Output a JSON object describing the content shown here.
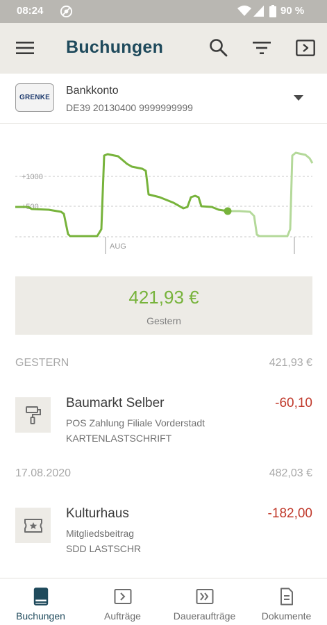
{
  "status_bar": {
    "time": "08:24",
    "battery": "90 %"
  },
  "app_bar": {
    "title": "Buchungen",
    "icons": [
      "menu-icon",
      "search-icon",
      "filter-icon",
      "export-icon"
    ]
  },
  "account": {
    "logo_text": "GRENKE",
    "name": "Bankkonto",
    "iban": "DE39 20130400 9999999999"
  },
  "chart_data": {
    "type": "line",
    "y_tick_labels": [
      "+1000",
      "+500"
    ],
    "x_tick_labels": [
      "AUG"
    ],
    "colors": {
      "past": "#77b33b",
      "forecast": "#b4d99a"
    }
  },
  "balance": {
    "amount": "421,93 €",
    "label": "Gestern"
  },
  "sections": [
    {
      "date": "GESTERN",
      "total": "421,93 €",
      "transactions": [
        {
          "title": "Baumarkt Selber",
          "line1": "POS Zahlung Filiale Vorderstadt",
          "line2": "KARTENLASTSCHRIFT",
          "amount": "-60,10",
          "icon": "paint-roller-icon"
        }
      ]
    },
    {
      "date": "17.08.2020",
      "total": "482,03 €",
      "transactions": [
        {
          "title": "Kulturhaus",
          "line1": "Mitgliedsbeitrag",
          "line2": "SDD LASTSCHR",
          "amount": "-182,00",
          "icon": "ticket-icon"
        }
      ]
    }
  ],
  "bottom_nav": [
    {
      "label": "Buchungen",
      "icon": "book-icon",
      "active": true
    },
    {
      "label": "Aufträge",
      "icon": "transfer-icon",
      "active": false
    },
    {
      "label": "Daueraufträge",
      "icon": "recurring-transfer-icon",
      "active": false
    },
    {
      "label": "Dokumente",
      "icon": "document-icon",
      "active": false
    }
  ],
  "colors": {
    "accent": "#1f4a5c",
    "positive": "#77b33b",
    "negative": "#c0392b",
    "appbar_bg": "#edebe6"
  }
}
